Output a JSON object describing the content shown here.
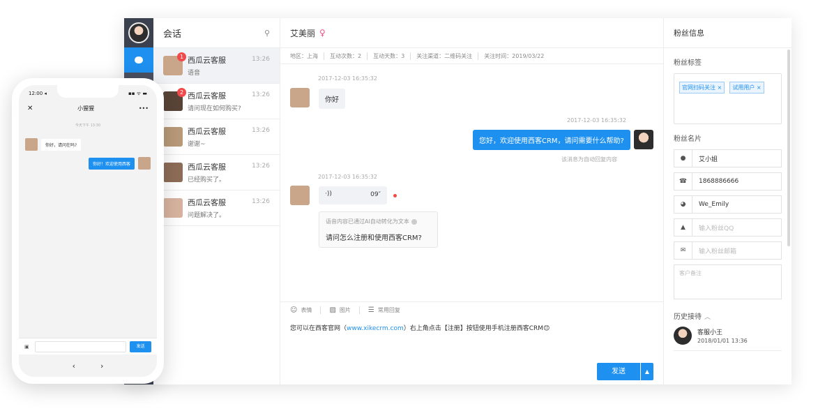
{
  "colors": {
    "accent": "#1e90f0",
    "rail": "#3c4150",
    "badge": "#f04a4a",
    "gender": "#f0508a"
  },
  "conversations": {
    "title": "会话",
    "filter_icon": "filter-icon",
    "items": [
      {
        "name": "西瓜云客服",
        "preview": "语音",
        "time": "13:26",
        "badge": "1",
        "avatar": "#c9a58a"
      },
      {
        "name": "西瓜云客服",
        "preview": "请问现在如何购买?",
        "time": "13:26",
        "badge": "2",
        "avatar": "#5a4438"
      },
      {
        "name": "西瓜云客服",
        "preview": "谢谢~",
        "time": "13:26",
        "badge": "",
        "avatar": "#b99a7a"
      },
      {
        "name": "西瓜云客服",
        "preview": "已经购买了。",
        "time": "13:26",
        "badge": "",
        "avatar": "#8e6d58"
      },
      {
        "name": "西瓜云客服",
        "preview": "问题解决了。",
        "time": "13:26",
        "badge": "",
        "avatar": "#d8b4a0"
      }
    ]
  },
  "chat": {
    "contact_name": "艾美丽",
    "gender_icon": "♀",
    "meta": [
      "地区：上海",
      "互动次数：2",
      "互动天数：3",
      "关注渠道：二维码关注",
      "关注时间：2019/03/22"
    ],
    "messages": {
      "ts1": "2017-12-03 16:35:32",
      "m1": "你好",
      "ts2": "2017-12-03 16:35:32",
      "m2": "您好，欢迎使用西客CRM，请问需要什么帮助?",
      "auto_note": "该消息为自动回复内容",
      "ts3": "2017-12-03 16:35:32",
      "voice_icon": "·))",
      "voice_duration": "09″",
      "ai_note": "语音内容已通过AI自动转化为文本",
      "ai_text": "请问怎么注册和使用西客CRM?"
    },
    "toolbar": {
      "emoji": "表情",
      "image": "图片",
      "quick_reply": "常用回复"
    },
    "compose": {
      "pre": "您可以在西客官网（",
      "link": "www.xikecrm.com",
      "post": "）右上角点击【注册】按钮使用手机注册西客CRM😊"
    },
    "send_label": "发送",
    "send_more": "▲"
  },
  "fan": {
    "title": "粉丝信息",
    "tags_title": "粉丝标签",
    "tags": [
      "官网扫码关注 ×",
      "试用用户 ×"
    ],
    "card_title": "粉丝名片",
    "name": "艾小姐",
    "phone": "1868886666",
    "wechat": "We_Emily",
    "qq_placeholder": "输入粉丝QQ",
    "email_placeholder": "输入粉丝邮箱",
    "remark_placeholder": "客户备注",
    "history_title": "历史接待",
    "history_chevron": "︿",
    "agent_name": "客服小王",
    "agent_time": "2018/01/01  13:36"
  },
  "phone": {
    "time": "12:00 ◂",
    "signal": "▪▪ ᯤ ▬",
    "title": "小猩猩",
    "close": "✕",
    "more": "•••",
    "timestamp": "今天下午 13:30",
    "msg_in": "你好，请问在吗?",
    "msg_out": "你好！欢迎使用西客",
    "send_label": "发送",
    "back": "‹",
    "forward": "›"
  }
}
